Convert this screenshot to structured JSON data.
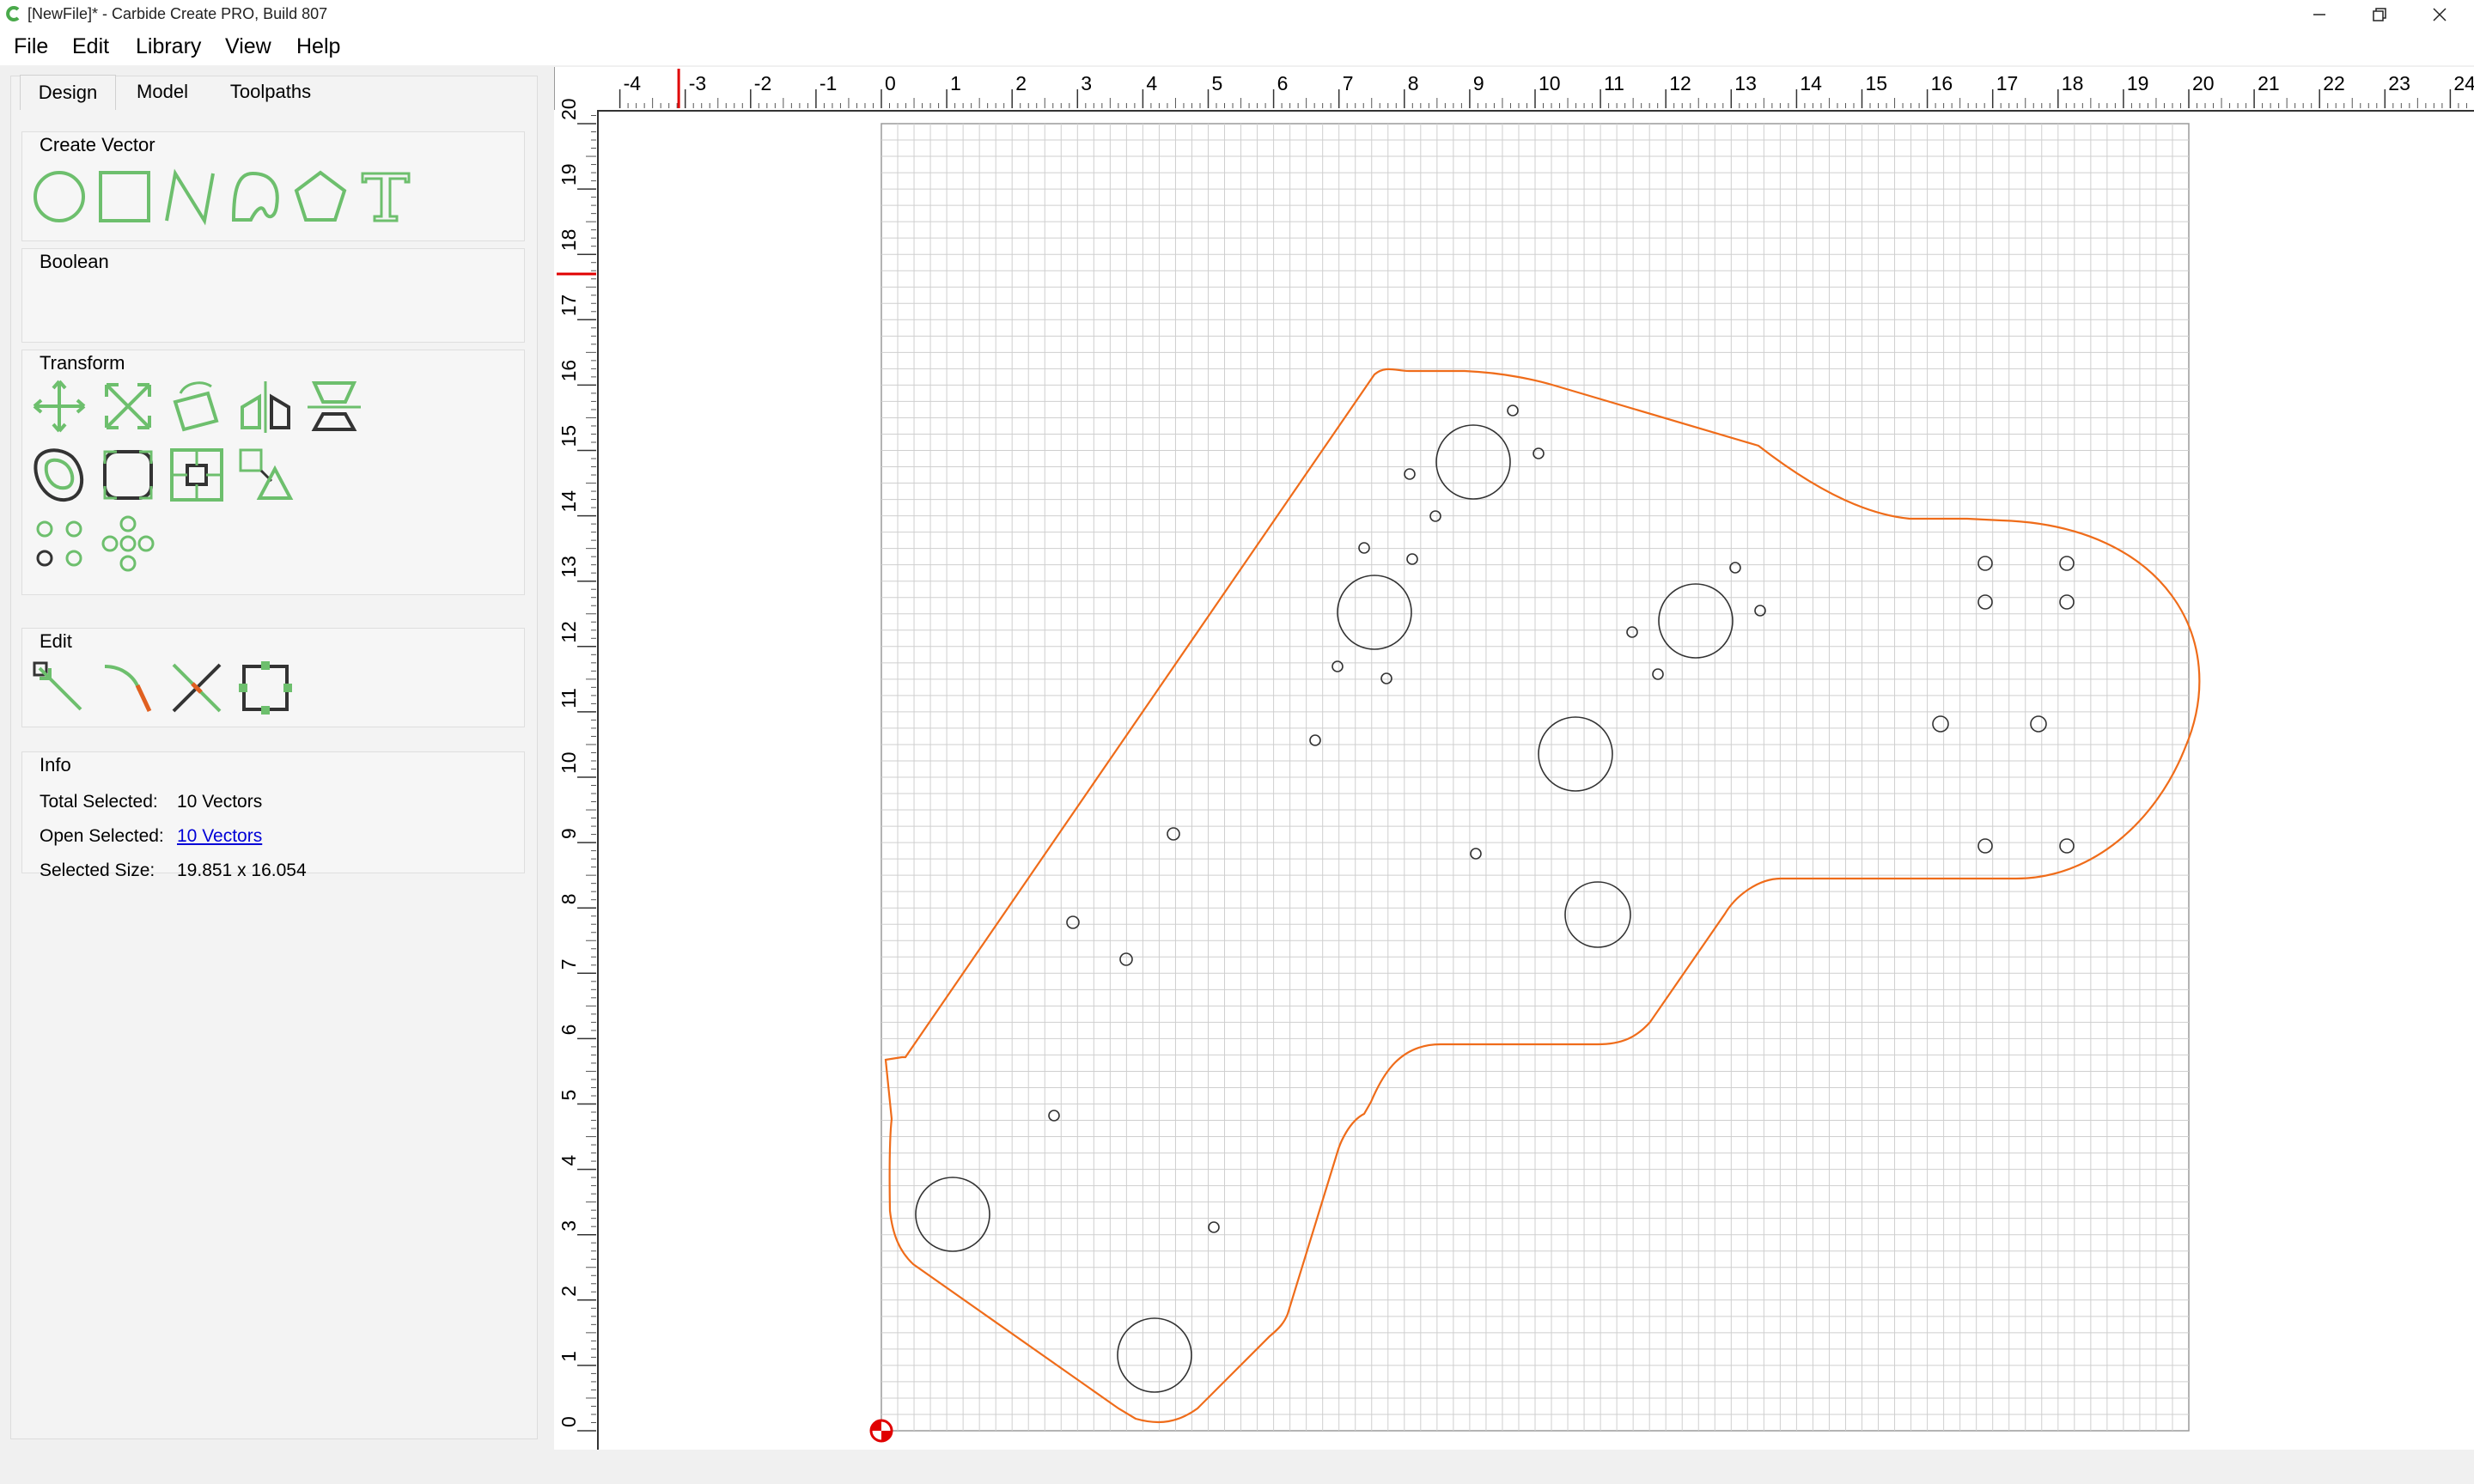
{
  "window": {
    "title": "[NewFile]* - Carbide Create PRO, Build 807",
    "minimize_icon": "minimize-icon",
    "maximize_icon": "restore-icon",
    "close_icon": "close-icon"
  },
  "menu": [
    "File",
    "Edit",
    "Library",
    "View",
    "Help"
  ],
  "tabs": [
    "Design",
    "Model",
    "Toolpaths"
  ],
  "active_tab": "Design",
  "groups": {
    "create_vector": "Create Vector",
    "boolean": "Boolean",
    "transform": "Transform",
    "edit": "Edit",
    "info": "Info"
  },
  "create_vector_tools": [
    "circle-icon",
    "rectangle-icon",
    "polyline-icon",
    "curve-icon",
    "polygon-icon",
    "text-icon"
  ],
  "transform_tools": [
    "move-icon",
    "scale-icon",
    "rotate-icon",
    "mirror-icon",
    "align-icon",
    "offset-icon",
    "fillet-icon",
    "center-icon",
    "scale-to-fit-icon",
    "grid-array-icon",
    "circular-array-icon"
  ],
  "edit_tools": [
    "node-edit-icon",
    "curve-edit-icon",
    "trim-icon",
    "bounding-box-icon"
  ],
  "info": {
    "total_selected_label": "Total Selected:",
    "total_selected_value": "10 Vectors",
    "open_selected_label": "Open Selected:",
    "open_selected_value": "10 Vectors",
    "selected_size_label": "Selected Size:",
    "selected_size_value": "19.851 x 16.054"
  },
  "ruler": {
    "x_ticks": [
      "-4",
      "-3",
      "-2",
      "-1",
      "0",
      "1",
      "2",
      "3",
      "4",
      "5",
      "6",
      "7",
      "8",
      "9",
      "10",
      "11",
      "12",
      "13",
      "14",
      "15",
      "16",
      "17",
      "18",
      "19",
      "20",
      "21",
      "22",
      "23",
      "24"
    ],
    "y_ticks": [
      "0",
      "1",
      "2",
      "3",
      "4",
      "5",
      "6",
      "7",
      "8",
      "9",
      "10",
      "11",
      "12",
      "13",
      "14",
      "15",
      "16",
      "17",
      "18",
      "19",
      "20"
    ],
    "cursor_x": -3.1,
    "cursor_y": 17.7
  },
  "colors": {
    "accent_green": "#6dbf6d",
    "toolpath_orange": "#ef6c1a",
    "grid": "#cfcfcf",
    "origin_red": "#e00000"
  },
  "stock": {
    "width": 20,
    "height": 20
  }
}
